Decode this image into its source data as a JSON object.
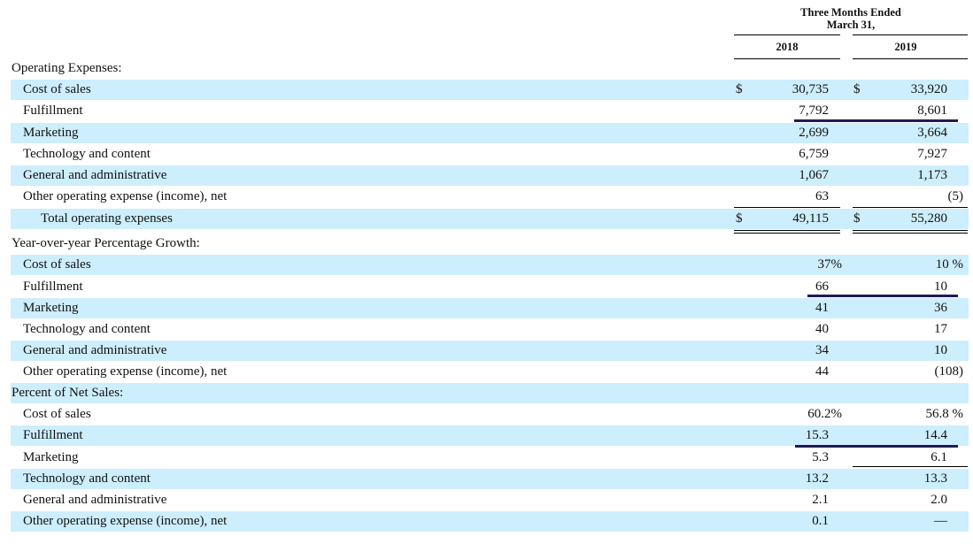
{
  "header": {
    "period_title": "Three Months Ended\nMarch 31,",
    "year1": "2018",
    "year2": "2019"
  },
  "currency_symbol": "$",
  "rows": [
    {
      "label": "Operating Expenses:",
      "v1": "",
      "v2": ""
    },
    {
      "label": "Cost of sales",
      "v1": "30,735",
      "v2": "33,920"
    },
    {
      "label": "Fulfillment",
      "v1": "7,792",
      "v2": "8,601"
    },
    {
      "label": "Marketing",
      "v1": "2,699",
      "v2": "3,664"
    },
    {
      "label": "Technology and content",
      "v1": "6,759",
      "v2": "7,927"
    },
    {
      "label": "General and administrative",
      "v1": "1,067",
      "v2": "1,173"
    },
    {
      "label": "Other operating expense (income), net",
      "v1": "63",
      "v2": "(5)"
    },
    {
      "label": "Total operating expenses",
      "v1": "49,115",
      "v2": "55,280"
    },
    {
      "label": "Year-over-year Percentage Growth:",
      "v1": "",
      "v2": ""
    },
    {
      "label": "Cost of sales",
      "v1": "37%",
      "v2": "10 %"
    },
    {
      "label": "Fulfillment",
      "v1": "66",
      "v2": "10"
    },
    {
      "label": "Marketing",
      "v1": "41",
      "v2": "36"
    },
    {
      "label": "Technology and content",
      "v1": "40",
      "v2": "17"
    },
    {
      "label": "General and administrative",
      "v1": "34",
      "v2": "10"
    },
    {
      "label": "Other operating expense (income), net",
      "v1": "44",
      "v2": "(108)"
    },
    {
      "label": "Percent of Net Sales:",
      "v1": "",
      "v2": ""
    },
    {
      "label": "Cost of sales",
      "v1": "60.2%",
      "v2": "56.8 %"
    },
    {
      "label": "Fulfillment",
      "v1": "15.3",
      "v2": "14.4"
    },
    {
      "label": "Marketing",
      "v1": "5.3",
      "v2": "6.1"
    },
    {
      "label": "Technology and content",
      "v1": "13.2",
      "v2": "13.3"
    },
    {
      "label": "General and administrative",
      "v1": "2.1",
      "v2": "2.0"
    },
    {
      "label": "Other operating expense (income), net",
      "v1": "0.1",
      "v2": "—"
    }
  ],
  "colors": {
    "row_highlight": "#cdeefd",
    "accent_line": "#231a52"
  }
}
